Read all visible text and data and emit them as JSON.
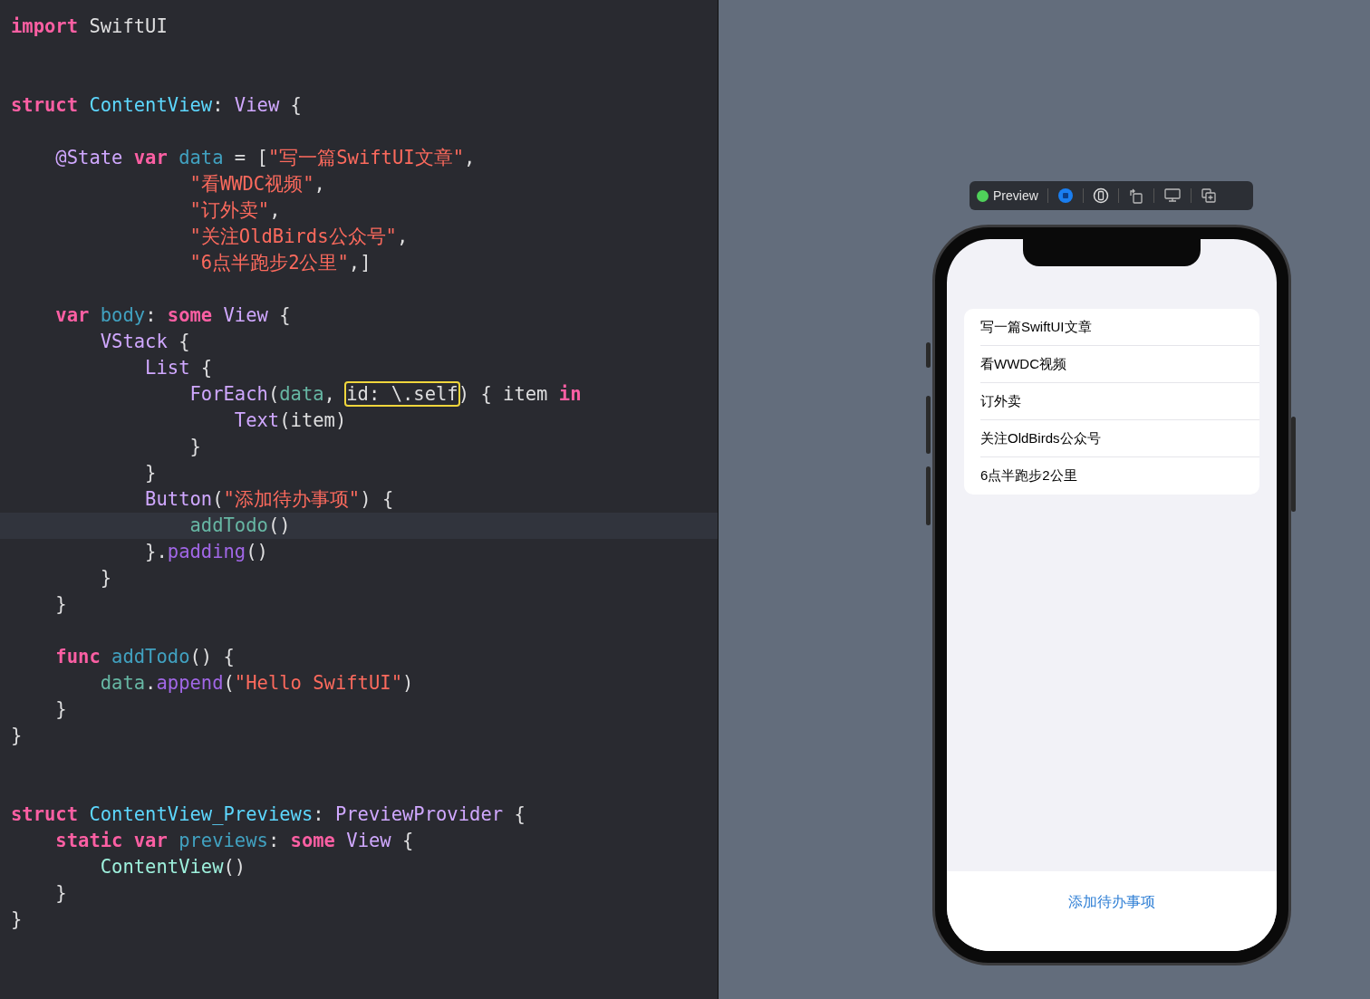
{
  "editor": {
    "lines": [
      {
        "kind": "code",
        "current": false,
        "tokens": [
          {
            "kind": "keyword",
            "text": "import"
          },
          {
            "kind": "plain",
            "text": " SwiftUI"
          }
        ]
      },
      {
        "kind": "blank"
      },
      {
        "kind": "blank"
      },
      {
        "kind": "code",
        "current": false,
        "tokens": [
          {
            "kind": "keyword",
            "text": "struct"
          },
          {
            "kind": "decl",
            "text": " ContentView"
          },
          {
            "kind": "plain",
            "text": ": "
          },
          {
            "kind": "type",
            "text": "View"
          },
          {
            "kind": "plain",
            "text": " {"
          }
        ]
      },
      {
        "kind": "blank"
      },
      {
        "kind": "code",
        "current": false,
        "tokens": [
          {
            "kind": "type",
            "text": "    @State"
          },
          {
            "kind": "keyword",
            "text": " var"
          },
          {
            "kind": "ident",
            "text": " data"
          },
          {
            "kind": "plain",
            "text": " = ["
          },
          {
            "kind": "string",
            "text": "\"写一篇SwiftUI文章\""
          },
          {
            "kind": "plain",
            "text": ","
          }
        ]
      },
      {
        "kind": "code",
        "current": false,
        "tokens": [
          {
            "kind": "string",
            "text": "                \"看WWDC视频\""
          },
          {
            "kind": "plain",
            "text": ","
          }
        ]
      },
      {
        "kind": "code",
        "current": false,
        "tokens": [
          {
            "kind": "string",
            "text": "                \"订外卖\""
          },
          {
            "kind": "plain",
            "text": ","
          }
        ]
      },
      {
        "kind": "code",
        "current": false,
        "tokens": [
          {
            "kind": "string",
            "text": "                \"关注OldBirds公众号\""
          },
          {
            "kind": "plain",
            "text": ","
          }
        ]
      },
      {
        "kind": "code",
        "current": false,
        "tokens": [
          {
            "kind": "string",
            "text": "                \"6点半跑步2公里\""
          },
          {
            "kind": "plain",
            "text": ",]"
          }
        ]
      },
      {
        "kind": "blank"
      },
      {
        "kind": "code",
        "current": false,
        "tokens": [
          {
            "kind": "keyword",
            "text": "    var"
          },
          {
            "kind": "ident",
            "text": " body"
          },
          {
            "kind": "plain",
            "text": ": "
          },
          {
            "kind": "keyword",
            "text": "some"
          },
          {
            "kind": "type",
            "text": " View"
          },
          {
            "kind": "plain",
            "text": " {"
          }
        ]
      },
      {
        "kind": "code",
        "current": false,
        "tokens": [
          {
            "kind": "type",
            "text": "        VStack"
          },
          {
            "kind": "plain",
            "text": " {"
          }
        ]
      },
      {
        "kind": "code",
        "current": false,
        "tokens": [
          {
            "kind": "type",
            "text": "            List"
          },
          {
            "kind": "plain",
            "text": " {"
          }
        ]
      },
      {
        "kind": "code",
        "current": false,
        "tokens": [
          {
            "kind": "type",
            "text": "                ForEach"
          },
          {
            "kind": "plain",
            "text": "("
          },
          {
            "kind": "ref",
            "text": "data"
          },
          {
            "kind": "plain",
            "text": ", "
          },
          {
            "kind": "boxed",
            "text": "id: \\.self"
          },
          {
            "kind": "plain",
            "text": ") { item "
          },
          {
            "kind": "keyword",
            "text": "in"
          }
        ]
      },
      {
        "kind": "code",
        "current": false,
        "tokens": [
          {
            "kind": "type",
            "text": "                    Text"
          },
          {
            "kind": "plain",
            "text": "(item)"
          }
        ]
      },
      {
        "kind": "code",
        "current": false,
        "tokens": [
          {
            "kind": "plain",
            "text": "                }"
          }
        ]
      },
      {
        "kind": "code",
        "current": false,
        "tokens": [
          {
            "kind": "plain",
            "text": "            }"
          }
        ]
      },
      {
        "kind": "code",
        "current": false,
        "tokens": [
          {
            "kind": "type",
            "text": "            Button"
          },
          {
            "kind": "plain",
            "text": "("
          },
          {
            "kind": "string",
            "text": "\"添加待办事项\""
          },
          {
            "kind": "plain",
            "text": ") {"
          }
        ]
      },
      {
        "kind": "code",
        "current": true,
        "tokens": [
          {
            "kind": "ref",
            "text": "                addTodo"
          },
          {
            "kind": "plain",
            "text": "()"
          }
        ]
      },
      {
        "kind": "code",
        "current": false,
        "tokens": [
          {
            "kind": "plain",
            "text": "            }."
          },
          {
            "kind": "method",
            "text": "padding"
          },
          {
            "kind": "plain",
            "text": "()"
          }
        ]
      },
      {
        "kind": "code",
        "current": false,
        "tokens": [
          {
            "kind": "plain",
            "text": "        }"
          }
        ]
      },
      {
        "kind": "code",
        "current": false,
        "tokens": [
          {
            "kind": "plain",
            "text": "    }"
          }
        ]
      },
      {
        "kind": "blank"
      },
      {
        "kind": "code",
        "current": false,
        "tokens": [
          {
            "kind": "keyword",
            "text": "    func"
          },
          {
            "kind": "ident",
            "text": " addTodo"
          },
          {
            "kind": "plain",
            "text": "() {"
          }
        ]
      },
      {
        "kind": "code",
        "current": false,
        "tokens": [
          {
            "kind": "ref",
            "text": "        data"
          },
          {
            "kind": "plain",
            "text": "."
          },
          {
            "kind": "method",
            "text": "append"
          },
          {
            "kind": "plain",
            "text": "("
          },
          {
            "kind": "string",
            "text": "\"Hello SwiftUI\""
          },
          {
            "kind": "plain",
            "text": ")"
          }
        ]
      },
      {
        "kind": "code",
        "current": false,
        "tokens": [
          {
            "kind": "plain",
            "text": "    }"
          }
        ]
      },
      {
        "kind": "code",
        "current": false,
        "tokens": [
          {
            "kind": "plain",
            "text": "}"
          }
        ]
      },
      {
        "kind": "blank"
      },
      {
        "kind": "blank"
      },
      {
        "kind": "code",
        "current": false,
        "tokens": [
          {
            "kind": "keyword",
            "text": "struct"
          },
          {
            "kind": "decl",
            "text": " ContentView_Previews"
          },
          {
            "kind": "plain",
            "text": ": "
          },
          {
            "kind": "type",
            "text": "PreviewProvider"
          },
          {
            "kind": "plain",
            "text": " {"
          }
        ]
      },
      {
        "kind": "code",
        "current": false,
        "tokens": [
          {
            "kind": "keyword",
            "text": "    static var"
          },
          {
            "kind": "ident",
            "text": " previews"
          },
          {
            "kind": "plain",
            "text": ": "
          },
          {
            "kind": "keyword",
            "text": "some"
          },
          {
            "kind": "type",
            "text": " View"
          },
          {
            "kind": "plain",
            "text": " {"
          }
        ]
      },
      {
        "kind": "code",
        "current": false,
        "tokens": [
          {
            "kind": "call",
            "text": "        ContentView"
          },
          {
            "kind": "plain",
            "text": "()"
          }
        ]
      },
      {
        "kind": "code",
        "current": false,
        "tokens": [
          {
            "kind": "plain",
            "text": "    }"
          }
        ]
      },
      {
        "kind": "code",
        "current": false,
        "tokens": [
          {
            "kind": "plain",
            "text": "}"
          }
        ]
      }
    ]
  },
  "preview": {
    "toolbar": {
      "label": "Preview"
    },
    "list_items": [
      "写一篇SwiftUI文章",
      "看WWDC视频",
      "订外卖",
      "关注OldBirds公众号",
      "6点半跑步2公里"
    ],
    "button": "添加待办事项"
  }
}
